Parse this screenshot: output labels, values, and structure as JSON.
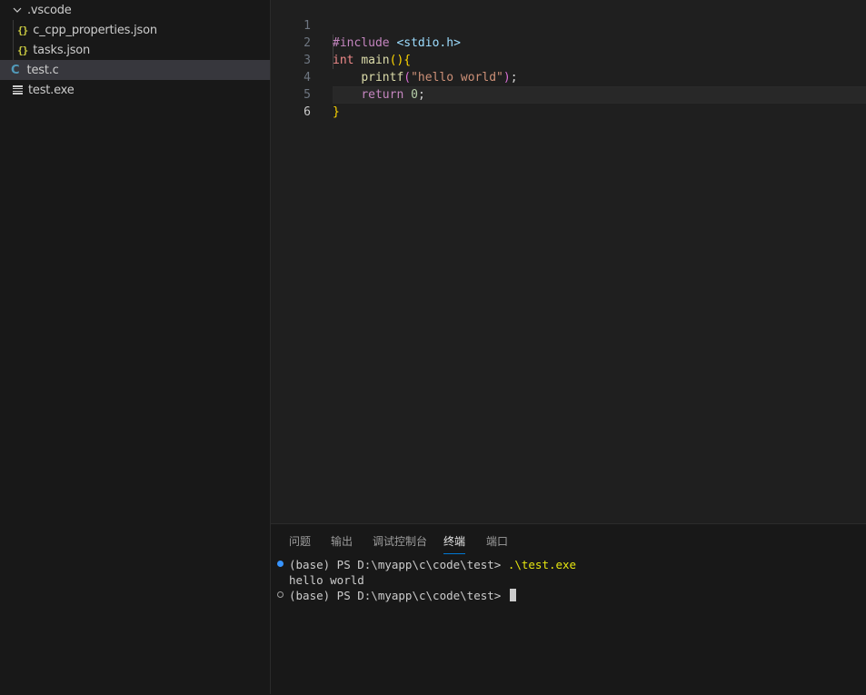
{
  "explorer": {
    "folder_name": ".vscode",
    "files": [
      {
        "name": "c_cpp_properties.json",
        "icon": "json-icon"
      },
      {
        "name": "tasks.json",
        "icon": "json-icon"
      },
      {
        "name": "test.c",
        "icon": "c-file-icon",
        "selected": true
      },
      {
        "name": "test.exe",
        "icon": "exe-file-icon"
      }
    ],
    "json_glyph": "{}",
    "c_glyph": "C"
  },
  "editor": {
    "line_numbers": [
      "1",
      "2",
      "3",
      "4",
      "5",
      "6"
    ],
    "code": {
      "l1_directive": "#include",
      "l1_header": "<stdio.h>",
      "l2_type": "int",
      "l2_name": "main",
      "l2_parens": "()",
      "l2_brace": "{",
      "l3_fn": "printf",
      "l3_open": "(",
      "l3_string": "\"hello world\"",
      "l3_close": ")",
      "l3_semi": ";",
      "l4_kw": "return",
      "l4_num": "0",
      "l4_semi": ";",
      "l5_brace": "}"
    },
    "active_line": 6
  },
  "panel": {
    "tabs": [
      "问题",
      "输出",
      "调试控制台",
      "终端",
      "端口"
    ],
    "active_tab": "终端",
    "terminal": {
      "prompt1": "(base) PS D:\\myapp\\c\\code\\test> ",
      "command1": ".\\test.exe",
      "output1": "hello world",
      "prompt2": "(base) PS D:\\myapp\\c\\code\\test> "
    }
  },
  "colors": {
    "accent": "#0078d4",
    "json_icon": "#cbcb41",
    "c_icon": "#519aba",
    "terminal_success_dot": "#3794ff"
  }
}
